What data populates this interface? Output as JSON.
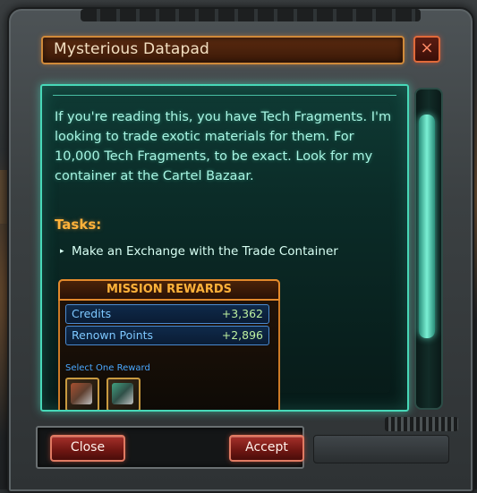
{
  "window": {
    "title": "Mysterious Datapad",
    "close_icon": "×"
  },
  "content": {
    "body": "If you're reading this, you have Tech Fragments. I'm looking to trade exotic materials for them. For 10,000 Tech Fragments, to be exact. Look for my container at the Cartel Bazaar.",
    "tasks_heading": "Tasks:",
    "task_bullet": "▸",
    "tasks": [
      "Make an Exchange with the Trade Container"
    ]
  },
  "rewards": {
    "title": "MISSION REWARDS",
    "rows": [
      {
        "label": "Credits",
        "value": "+3,362"
      },
      {
        "label": "Renown Points",
        "value": "+2,896"
      }
    ],
    "select_one_label": "Select One Reward"
  },
  "buttons": {
    "close": "Close",
    "accept": "Accept"
  },
  "colors": {
    "panel_glow": "#47d8b8",
    "accent_orange": "#ffb23a",
    "button_red": "#a5302a"
  }
}
